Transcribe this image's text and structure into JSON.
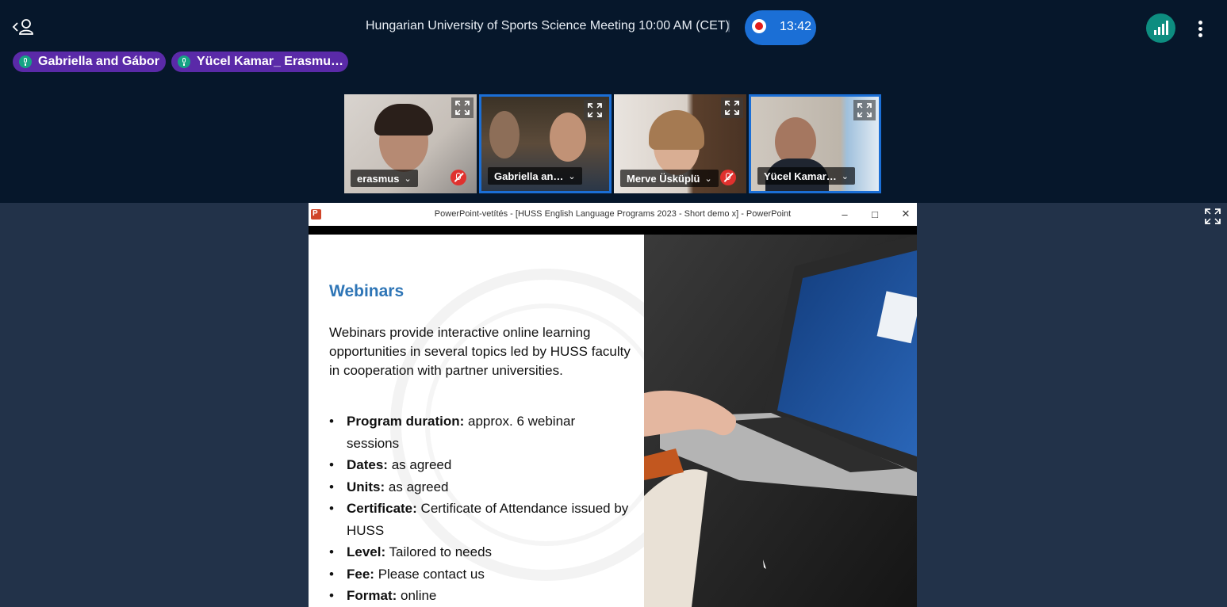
{
  "meeting": {
    "title": "Hungarian University of Sports Science Meeting 10:00 AM (CET)",
    "separator": "|",
    "recording_time": "13:42"
  },
  "icons": {
    "users": "users-icon",
    "recording": "record-icon",
    "connection": "signal-bars-icon",
    "more": "more-vertical-icon",
    "microphone": "microphone-icon",
    "muted": "microphone-muted-icon",
    "expand": "expand-icon",
    "powerpoint": "powerpoint-icon"
  },
  "colors": {
    "background": "#06172b",
    "stage": "#223249",
    "recording_pill": "#1b6fd6",
    "recording_dot": "#e21b1b",
    "talking_pill": "#5a2aa8",
    "mic_badge": "#16a384",
    "connection": "#0d8d80",
    "muted": "#e0312e",
    "slide_heading": "#2e75b6"
  },
  "talking": [
    {
      "name": "Gabriella and Gábor"
    },
    {
      "name": "Yücel Kamar_ Erasmu…"
    }
  ],
  "participants": [
    {
      "name": "erasmus",
      "muted": true,
      "speaking": false
    },
    {
      "name": "Gabriella an…",
      "muted": false,
      "speaking": true
    },
    {
      "name": "Merve Üsküplü",
      "muted": true,
      "speaking": false
    },
    {
      "name": "Yücel Kamar…",
      "muted": false,
      "speaking": true
    }
  ],
  "presentation": {
    "window_title": "PowerPoint-vetítés - [HUSS English Language Programs 2023 - Short demo x] - PowerPoint",
    "window_controls": {
      "minimize": "–",
      "restore": "□",
      "close": "✕"
    },
    "slide": {
      "heading": "Webinars",
      "intro": "Webinars provide interactive online learning opportunities in several topics led by HUSS faculty in cooperation with partner universities.",
      "items": [
        {
          "label": "Program duration:",
          "value": " approx. 6 webinar sessions"
        },
        {
          "label": "Dates:",
          "value": " as agreed"
        },
        {
          "label": "Units:",
          "value": " as agreed"
        },
        {
          "label": "Certificate:",
          "value": " Certificate of Attendance issued by HUSS"
        },
        {
          "label": "Level:",
          "value": " Tailored to needs"
        },
        {
          "label": "Fee:",
          "value": " Please contact us"
        },
        {
          "label": "Format:",
          "value": " online"
        }
      ]
    }
  }
}
